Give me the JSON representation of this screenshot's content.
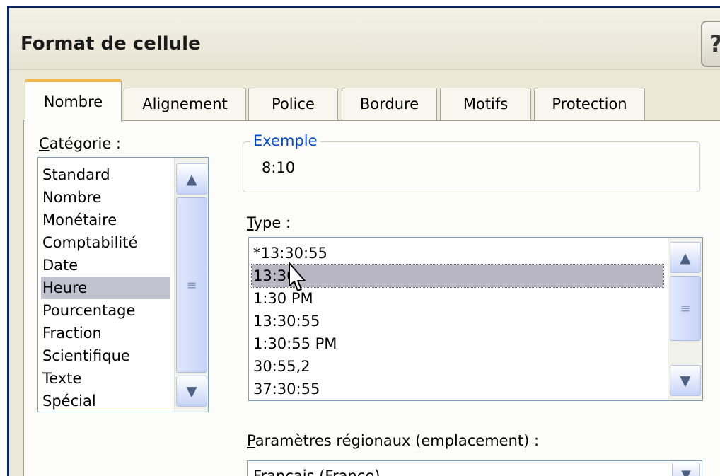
{
  "dialog": {
    "title": "Format de cellule",
    "help_glyph": "?"
  },
  "tabs": [
    {
      "label": "Nombre",
      "active": true
    },
    {
      "label": "Alignement",
      "active": false
    },
    {
      "label": "Police",
      "active": false
    },
    {
      "label": "Bordure",
      "active": false
    },
    {
      "label": "Motifs",
      "active": false
    },
    {
      "label": "Protection",
      "active": false
    }
  ],
  "category": {
    "label": "Catégorie :",
    "items": [
      "Standard",
      "Nombre",
      "Monétaire",
      "Comptabilité",
      "Date",
      "Heure",
      "Pourcentage",
      "Fraction",
      "Scientifique",
      "Texte",
      "Spécial"
    ],
    "selected": "Heure"
  },
  "sample": {
    "legend": "Exemple",
    "value": "8:10"
  },
  "type": {
    "label": "Type :",
    "items": [
      "*13:30:55",
      "13:30",
      "1:30 PM",
      "13:30:55",
      "1:30:55 PM",
      "30:55,2",
      "37:30:55"
    ],
    "selected": "13:30"
  },
  "locale": {
    "label": "Paramètres régionaux (emplacement) :",
    "value": "Français (France)"
  },
  "icons": {
    "scroll_up": "chevron-up-icon",
    "scroll_down": "chevron-down-icon",
    "dropdown": "chevron-down-icon",
    "cursor": "mouse-pointer-icon"
  },
  "colors": {
    "accent_tab": "#f3b84c",
    "legend_text": "#0046d5",
    "selection": "#c2c1cf",
    "title_border": "#0a246a"
  }
}
